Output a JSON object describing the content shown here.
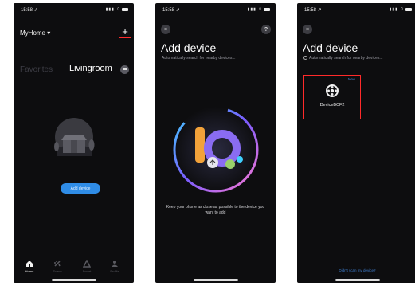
{
  "phone1": {
    "status": {
      "time": "15:58 ⇗",
      "indicators": "▮▮▮ ⌔"
    },
    "home_title": "MyHome ▾",
    "tabs": {
      "favorites": "Favorites",
      "room": "Livingroom"
    },
    "add_device_label": "Add device",
    "nav": {
      "home": "Home",
      "scene": "Scene",
      "smart": "Smart",
      "profile": "Profile"
    }
  },
  "phone2": {
    "status": {
      "time": "15:58 ⇗",
      "indicators": "▮▮▮ ⌔"
    },
    "close": "×",
    "help": "?",
    "title": "Add device",
    "subtitle": "Automatically search for nearby devices...",
    "instruction": "Keep your phone as close as possible to the device you want to add"
  },
  "phone3": {
    "status": {
      "time": "15:58 ⇗",
      "indicators": "▮▮▮ ⌔"
    },
    "close": "×",
    "title": "Add device",
    "subtitle": "Automatically search for nearby devices...",
    "device": {
      "badge": "New",
      "name": "DeviceBCF2"
    },
    "scan_link": "Didn't scan my device?"
  },
  "colors": {
    "highlight": "#ff2a2a",
    "accent": "#2f8ce6",
    "background": "#0d0d0f"
  }
}
